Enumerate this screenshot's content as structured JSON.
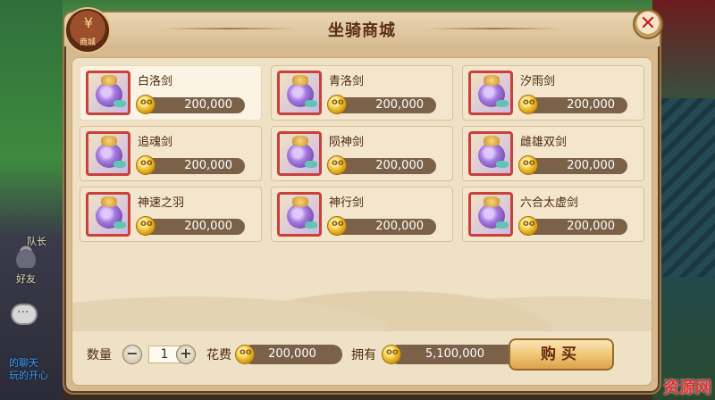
{
  "window": {
    "title": "坐骑商城",
    "logo_label": "商城"
  },
  "background": {
    "left_texts": [
      "队长",
      "好友",
      "的聊天",
      "玩的开心"
    ]
  },
  "items": [
    {
      "name": "白洛剑",
      "price": "200,000",
      "selected": true
    },
    {
      "name": "青洛剑",
      "price": "200,000"
    },
    {
      "name": "汐雨剑",
      "price": "200,000"
    },
    {
      "name": "追魂剑",
      "price": "200,000"
    },
    {
      "name": "陨神剑",
      "price": "200,000"
    },
    {
      "name": "雌雄双剑",
      "price": "200,000"
    },
    {
      "name": "神速之羽",
      "price": "200,000"
    },
    {
      "name": "神行剑",
      "price": "200,000"
    },
    {
      "name": "六合太虚剑",
      "price": "200,000"
    }
  ],
  "footer": {
    "quantity_label": "数量",
    "quantity_value": "1",
    "minus": "−",
    "plus": "+",
    "cost_label": "花费",
    "cost_value": "200,000",
    "owned_label": "拥有",
    "owned_value": "5,100,000",
    "buy_label": "购买"
  },
  "watermark": "资源网",
  "colors": {
    "panel": "#d6b98e",
    "item_border_red": "#c8413a",
    "price_bar": "#7a6148",
    "title_brown": "#5a2e14"
  },
  "icons": {
    "close": "close-icon",
    "coin": "gold-coin-icon",
    "logo": "shop-bag-icon"
  }
}
